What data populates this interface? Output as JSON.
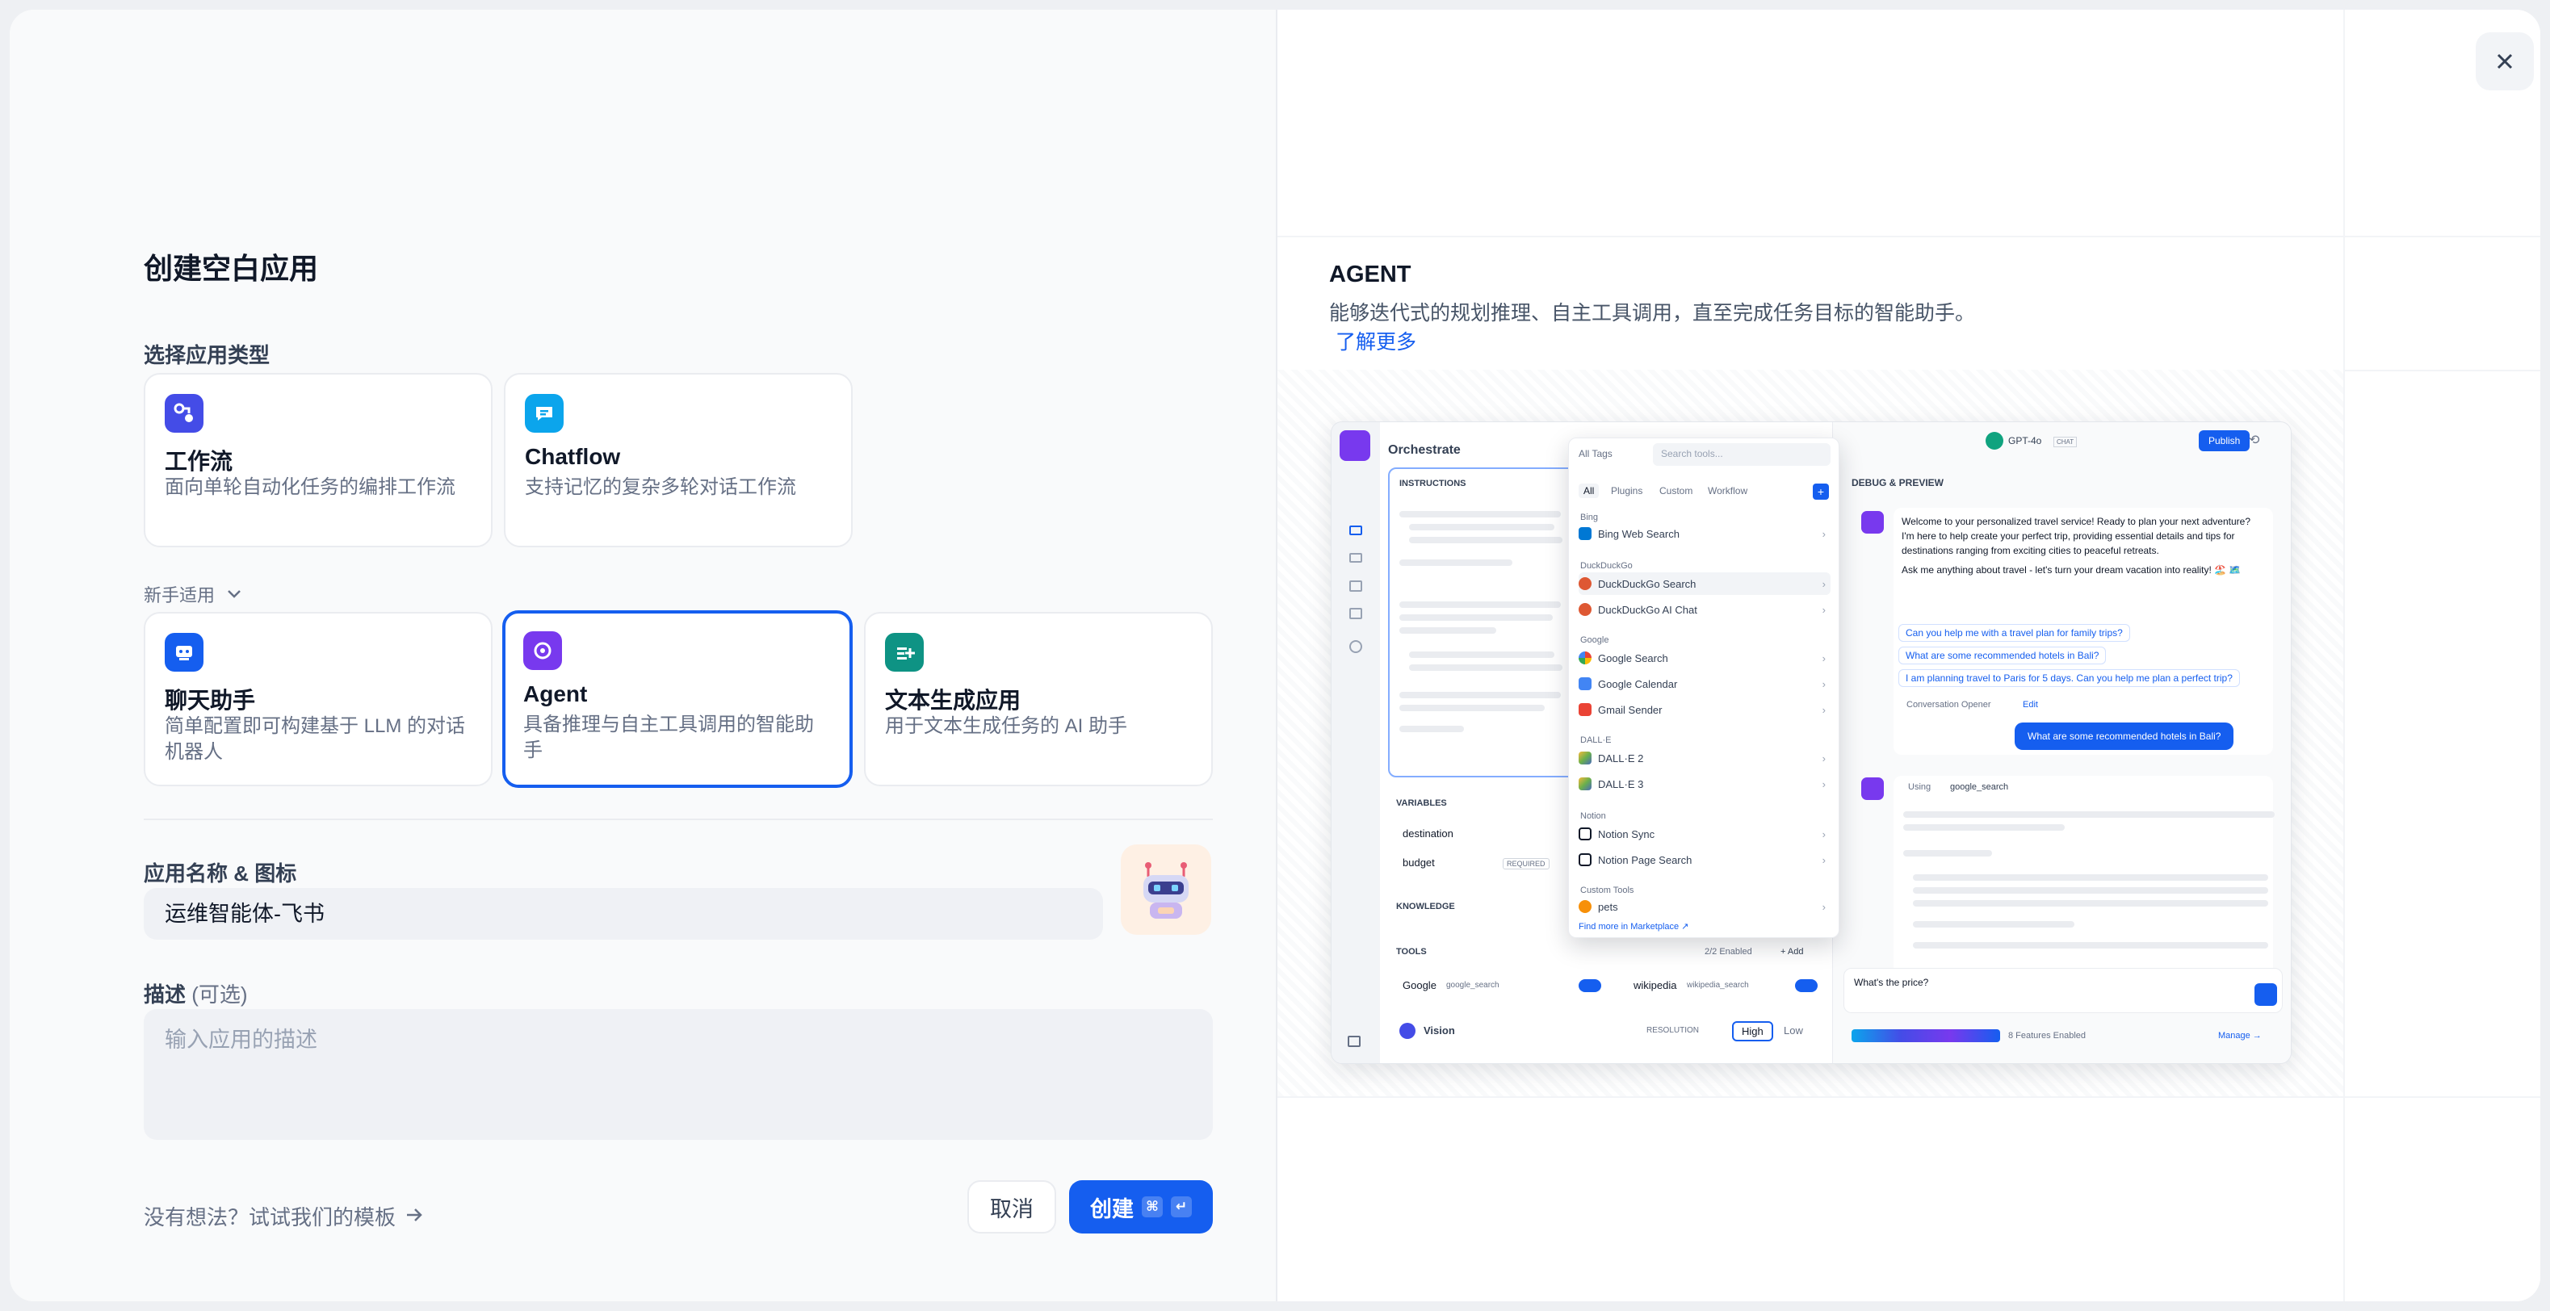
{
  "left": {
    "title": "创建空白应用",
    "choose_type_label": "选择应用类型",
    "cards_top": [
      {
        "name": "工作流",
        "desc": "面向单轮自动化任务的编排工作流",
        "icon": "workflow-icon",
        "color": "#444ce7"
      },
      {
        "name": "Chatflow",
        "desc": "支持记忆的复杂多轮对话工作流",
        "icon": "chatflow-icon",
        "color": "#0ba5ec"
      }
    ],
    "newbie_label": "新手适用",
    "cards_bottom": [
      {
        "name": "聊天助手",
        "desc": "简单配置即可构建基于 LLM 的对话机器人",
        "icon": "chat-assistant-icon",
        "color": "#155eef"
      },
      {
        "name": "Agent",
        "desc": "具备推理与自主工具调用的智能助手",
        "icon": "agent-icon",
        "color": "#7839ee",
        "selected": true
      },
      {
        "name": "文本生成应用",
        "desc": "用于文本生成任务的 AI 助手",
        "icon": "text-generation-icon",
        "color": "#0e9384"
      }
    ],
    "name_label": "应用名称 & 图标",
    "name_value": "运维智能体-飞书",
    "desc_label": "描述",
    "desc_optional": "(可选)",
    "desc_placeholder": "输入应用的描述",
    "template_link": "没有想法？试试我们的模板",
    "cancel": "取消",
    "create": "创建",
    "create_kbd_1": "⌘",
    "create_kbd_2": "↵"
  },
  "right": {
    "agent_title": "AGENT",
    "agent_desc": "能够迭代式的规划推理、自主工具调用，直至完成任务目标的智能助手。",
    "learn_more": "了解更多"
  },
  "preview": {
    "orchestrate": "Orchestrate",
    "instructions": "INSTRUCTIONS",
    "variables": "VARIABLES",
    "var1": "destination",
    "var2": "budget",
    "required": "REQUIRED",
    "knowledge": "KNOWLEDGE",
    "tools": "TOOLS",
    "tools_enabled": "2/2 Enabled",
    "add": "+ Add",
    "tool1_name": "Google",
    "tool1_id": "google_search",
    "tool2_name": "wikipedia",
    "tool2_id": "wikipedia_search",
    "vision": "Vision",
    "resolution": "RESOLUTION",
    "high": "High",
    "low": "Low",
    "model": "GPT-4o",
    "chat_badge": "CHAT",
    "publish": "Publish",
    "debug": "DEBUG & PREVIEW",
    "welcome": "Welcome to your personalized travel service! Ready to plan your next adventure? I'm here to help create your perfect trip, providing essential details and tips for destinations ranging from exciting cities to peaceful retreats.",
    "ask": "Ask me anything about travel - let's turn your dream vacation into reality! 🏖️ 🗺️",
    "q1": "Can you help me with a travel plan for family trips?",
    "q2": "What are some recommended hotels in Bali?",
    "q3": "I am planning travel to Paris for 5 days. Can you help me plan a perfect trip?",
    "opener": "Conversation Opener",
    "edit": "Edit",
    "user_msg": "What are some recommended hotels in Bali?",
    "using": "Using",
    "using_tool": "google_search",
    "input_text": "What's the price?",
    "features": "8 Features Enabled",
    "manage": "Manage →",
    "dropdown": {
      "all_tags": "All Tags",
      "search": "Search tools...",
      "tabs": [
        "All",
        "Plugins",
        "Custom",
        "Workflow"
      ],
      "groups": [
        {
          "label": "Bing",
          "items": [
            "Bing Web Search"
          ]
        },
        {
          "label": "DuckDuckGo",
          "items": [
            "DuckDuckGo Search",
            "DuckDuckGo AI Chat"
          ]
        },
        {
          "label": "Google",
          "items": [
            "Google Search",
            "Google Calendar",
            "Gmail Sender"
          ]
        },
        {
          "label": "DALL·E",
          "items": [
            "DALL·E 2",
            "DALL·E 3"
          ]
        },
        {
          "label": "Notion",
          "items": [
            "Notion Sync",
            "Notion Page Search"
          ]
        },
        {
          "label": "Custom Tools",
          "items": [
            "pets"
          ]
        }
      ],
      "find_more": "Find more in",
      "marketplace": "Marketplace ↗"
    }
  }
}
